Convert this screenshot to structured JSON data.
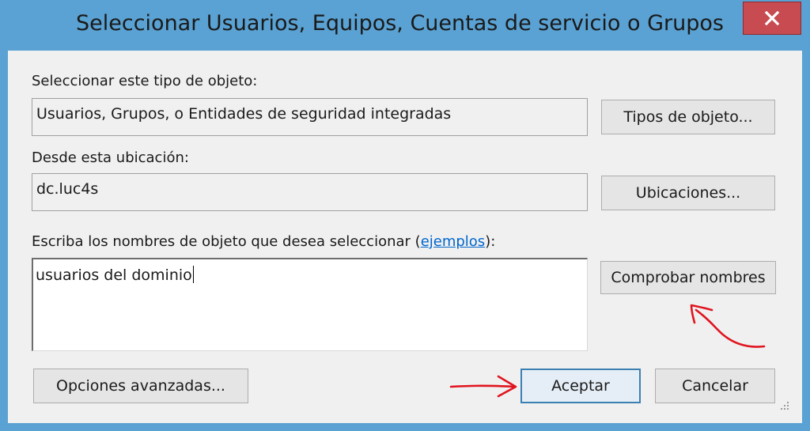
{
  "window": {
    "title": "Seleccionar Usuarios, Equipos, Cuentas de servicio o Grupos"
  },
  "object_type": {
    "label": "Seleccionar este tipo de objeto:",
    "value": "Usuarios, Grupos, o Entidades de seguridad integradas",
    "button_label": "Tipos de objeto..."
  },
  "location": {
    "label": "Desde esta ubicación:",
    "value": "dc.luc4s",
    "button_label": "Ubicaciones..."
  },
  "names": {
    "label_prefix": "Escriba los nombres de objeto que desea seleccionar (",
    "link": "ejemplos",
    "label_suffix": "):",
    "value": "usuarios del dominio",
    "check_button_label": "Comprobar nombres"
  },
  "footer": {
    "advanced_label": "Opciones avanzadas...",
    "ok_label": "Aceptar",
    "cancel_label": "Cancelar"
  },
  "colors": {
    "frame": "#5aa2d3",
    "close": "#c74b50",
    "annotation": "#e0141e"
  }
}
